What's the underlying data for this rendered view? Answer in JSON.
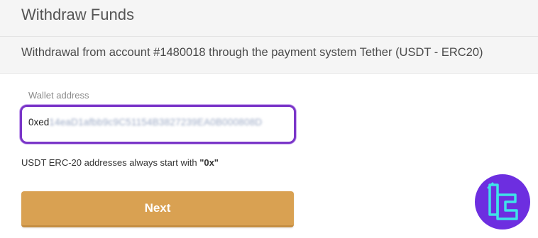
{
  "header": {
    "title": "Withdraw Funds"
  },
  "subtitle": "Withdrawal from account #1480018 through the payment system Tether (USDT - ERC20)",
  "wallet": {
    "label": "Wallet address",
    "value_visible": "0xed",
    "value_obscured": "14eaD1afbb9c9C51154B3827239EA0B000808D"
  },
  "hint": {
    "text": "USDT ERC-20 addresses always start with ",
    "prefix": "\"0x\""
  },
  "next_button": {
    "label": "Next"
  },
  "colors": {
    "accent_button": "#d9a152",
    "focus_border": "#7a35c8",
    "logo_bg": "#6d2ee0",
    "logo_mark": "#3fe3e8"
  },
  "icons": {
    "logo": "tradingfinder-logo-icon"
  }
}
